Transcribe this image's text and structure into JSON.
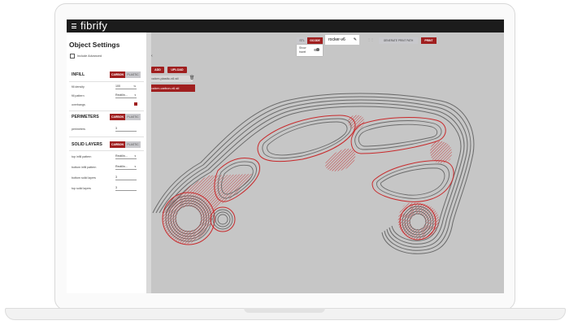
{
  "app": {
    "logo": "fibrify"
  },
  "toolbar": {
    "stl_label": "STL",
    "gcode_label": "GCODE",
    "show_travel_label": "Show travel",
    "filename": "rocker-v6",
    "generate_label": "GENERATE PRINT PATH",
    "print_label": "PRINT"
  },
  "files": {
    "add_label": "ADD",
    "upload_label": "UPLOAD",
    "items": [
      {
        "name": "rocker-plastic-v6.stl",
        "selected": false
      },
      {
        "name": "rocker-carbon-v6.stl",
        "selected": true
      }
    ]
  },
  "sidebar": {
    "title": "Object Settings",
    "include_advanced": "Include Advanced",
    "sections": [
      {
        "header": "INFILL",
        "carbon": "CARBON",
        "plastic": "PLASTIC",
        "rows": [
          {
            "label": "fill density",
            "value": "100",
            "suffix": "%"
          },
          {
            "label": "fill pattern",
            "value": "Rectilin...",
            "suffix": "▾"
          },
          {
            "label": "overhangs",
            "value": "",
            "suffix": ""
          }
        ]
      },
      {
        "header": "PERIMETERS",
        "carbon": "CARBON",
        "plastic": "PLASTIC",
        "rows": [
          {
            "label": "perimeters",
            "value": "3",
            "suffix": ""
          }
        ]
      },
      {
        "header": "SOLID LAYERS",
        "carbon": "CARBON",
        "plastic": "PLASTIC",
        "rows": [
          {
            "label": "top infill pattern",
            "value": "Rectilin...",
            "suffix": "▾"
          },
          {
            "label": "bottom infill pattern",
            "value": "Rectilin...",
            "suffix": "▾"
          },
          {
            "label": "bottom solid layers",
            "value": "3",
            "suffix": ""
          },
          {
            "label": "top solid layers",
            "value": "3",
            "suffix": ""
          }
        ]
      }
    ]
  },
  "colors": {
    "accent": "#a01f1f",
    "toolpath_gray": "#6a6a6a",
    "toolpath_red": "#c8292b",
    "canvas_bg": "#c6c6c6"
  }
}
